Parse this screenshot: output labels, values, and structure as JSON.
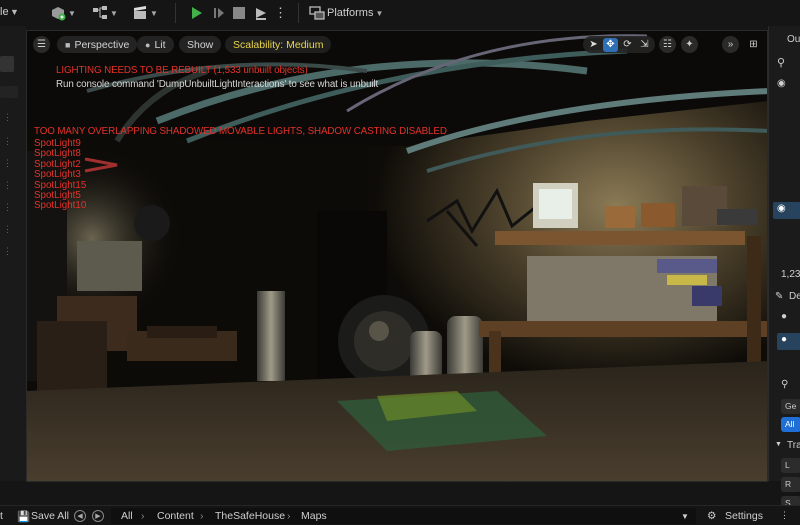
{
  "toolbar": {
    "partial_left_label": "le",
    "platforms_label": "Platforms"
  },
  "viewport": {
    "perspective_label": "Perspective",
    "lit_label": "Lit",
    "show_label": "Show",
    "scalability_label": "Scalability: Medium",
    "lighting_warning": "LIGHTING NEEDS TO BE REBUILT (1,533 unbuilt objects)",
    "console_hint": "Run console command 'DumpUnbuiltLightInteractions' to see what is unbuilt",
    "shadow_warning": "TOO MANY OVERLAPPING SHADOWED MOVABLE LIGHTS, SHADOW CASTING DISABLED",
    "spot_lights": [
      "SpotLight9",
      "SpotLight8",
      "SpotLight2",
      "SpotLight3",
      "SpotLight15",
      "SpotLight5",
      "SpotLight10"
    ]
  },
  "right_panel": {
    "partial_top": "Ou",
    "count_partial": "1,23",
    "details_partial": "De",
    "general_partial": "Ge",
    "all_partial": "All",
    "transform_partial": "Tra",
    "location_partial": "L",
    "rotation_partial": "R",
    "scale_partial": "S"
  },
  "bottom_bar": {
    "partial_left": "t",
    "save_all_label": "Save All",
    "breadcrumb": [
      "All",
      "Content",
      "TheSafeHouse",
      "Maps"
    ],
    "settings_label": "Settings"
  },
  "colors": {
    "accent_blue": "#2f6fb6",
    "play_green": "#43b049",
    "warning_red": "#e2322b",
    "scalability_yellow": "#e8d64a"
  }
}
